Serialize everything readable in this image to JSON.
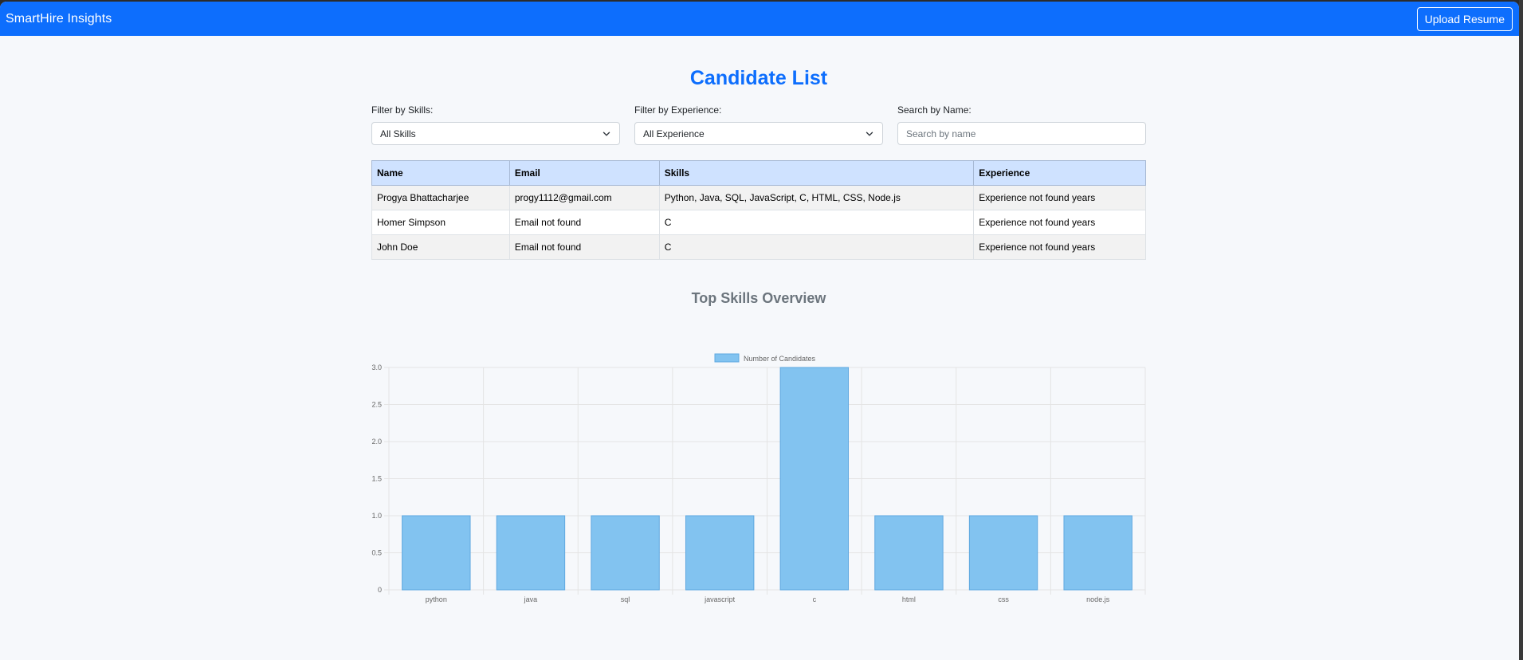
{
  "navbar": {
    "brand": "SmartHire Insights",
    "upload_label": "Upload Resume",
    "background": "#0d6efd"
  },
  "page": {
    "title": "Candidate List"
  },
  "filters": {
    "skills_label": "Filter by Skills:",
    "skills_value": "All Skills",
    "experience_label": "Filter by Experience:",
    "experience_value": "All Experience",
    "name_label": "Search by Name:",
    "name_placeholder": "Search by name",
    "name_value": ""
  },
  "table": {
    "headers": [
      "Name",
      "Email",
      "Skills",
      "Experience"
    ],
    "rows": [
      [
        "Progya Bhattacharjee",
        "progy1112@gmail.com",
        "Python, Java, SQL, JavaScript, C, HTML, CSS, Node.js",
        "Experience not found years"
      ],
      [
        "Homer Simpson",
        "Email not found",
        "C",
        "Experience not found years"
      ],
      [
        "John Doe",
        "Email not found",
        "C",
        "Experience not found years"
      ]
    ]
  },
  "chart_section": {
    "title": "Top Skills Overview"
  },
  "chart_data": {
    "type": "bar",
    "categories": [
      "python",
      "java",
      "sql",
      "javascript",
      "c",
      "html",
      "css",
      "node.js"
    ],
    "series": [
      {
        "name": "Number of Candidates",
        "values": [
          1,
          1,
          1,
          1,
          3,
          1,
          1,
          1
        ]
      }
    ],
    "ylim": [
      0,
      3
    ],
    "yticks": [
      "0",
      "0.5",
      "1.0",
      "1.5",
      "2.0",
      "2.5",
      "3.0"
    ],
    "ytick_values": [
      0,
      0.5,
      1.0,
      1.5,
      2.0,
      2.5,
      3.0
    ],
    "grid": true,
    "legend": "top-center",
    "bar_fill": "#82c3f0",
    "bar_stroke": "#5fa8e0"
  }
}
